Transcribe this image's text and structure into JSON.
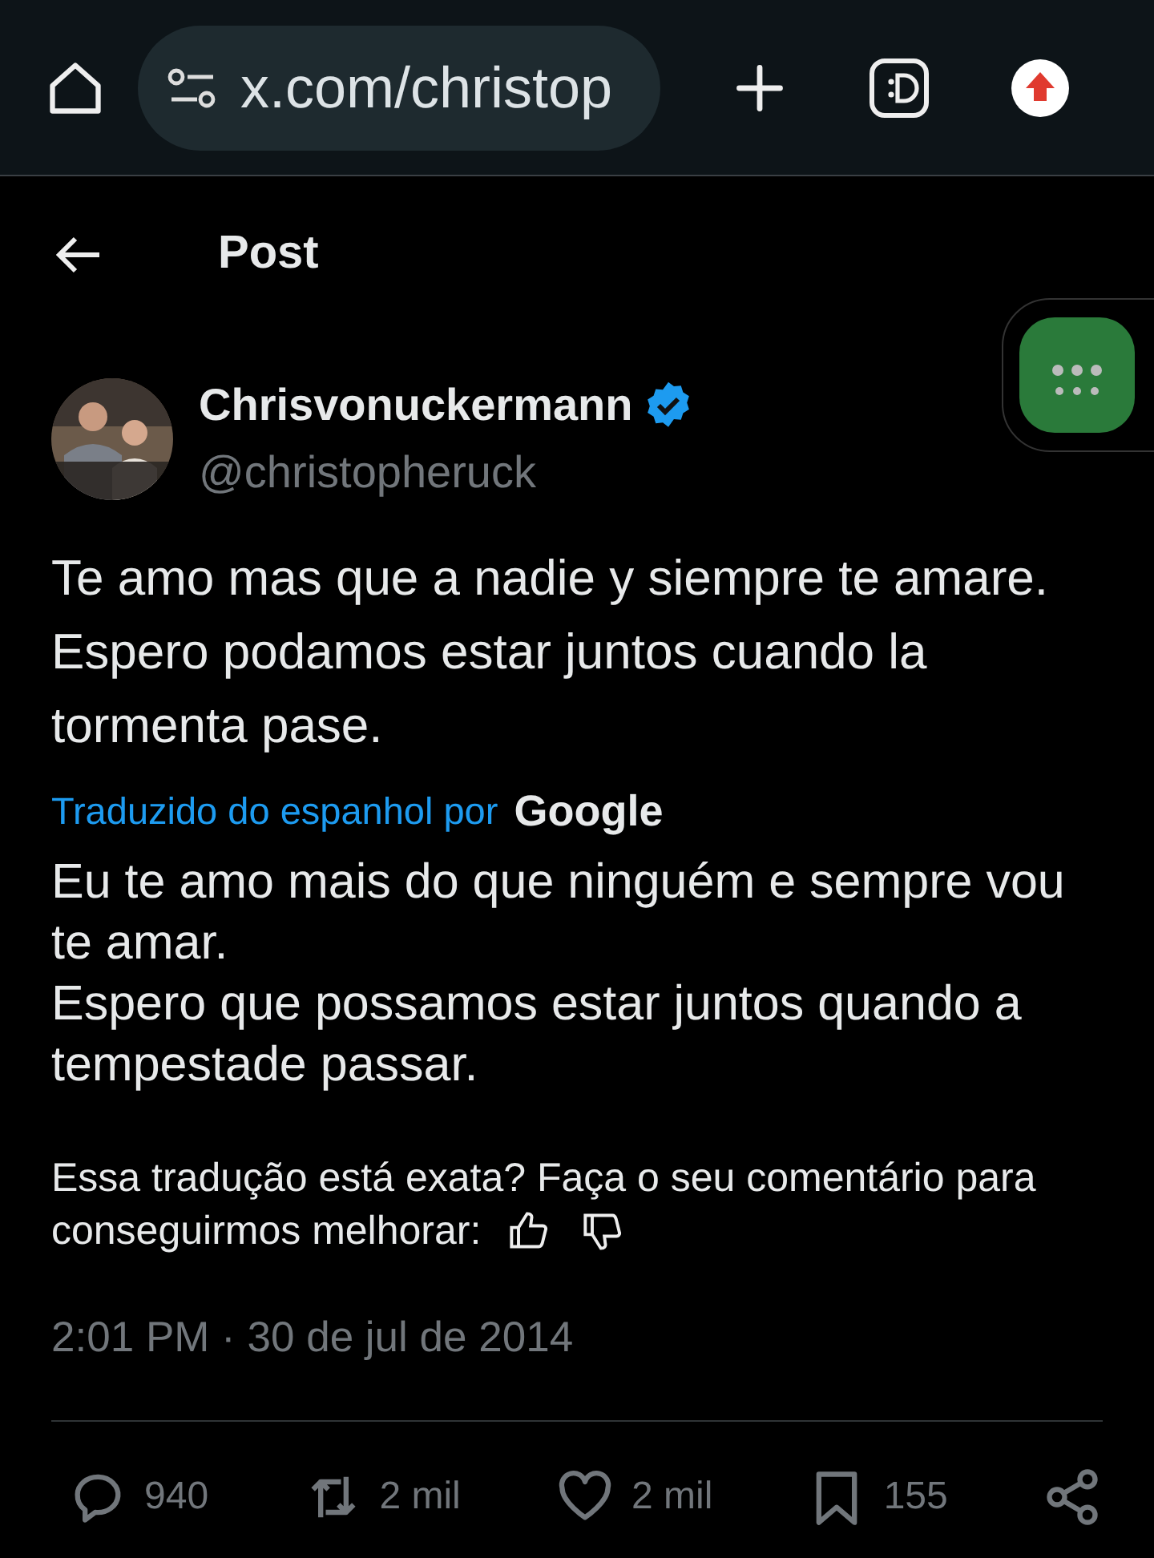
{
  "browser": {
    "url": "x.com/christop"
  },
  "header": {
    "title": "Post"
  },
  "author": {
    "name": "Chrisvonuckermann",
    "handle": "@christopheruck",
    "verified": true
  },
  "text": [
    "Te amo mas que a nadie y siempre te amare.",
    "Espero podamos estar juntos cuando la tormenta pase."
  ],
  "translation": {
    "label": "Traduzido do espanhol por",
    "provider": "Google",
    "text": [
      "Eu te amo mais do que ninguém e sempre vou te amar.",
      "Espero que possamos estar juntos quando a tempestade passar."
    ]
  },
  "feedback": [
    "Essa tradução está exata? Faça o seu comentário para",
    "conseguirmos melhorar:"
  ],
  "timestamp": "2:01 PM · 30 de jul de 2014",
  "actions": [
    {
      "kind": "reply",
      "count": "940"
    },
    {
      "kind": "repost",
      "count": "2 mil"
    },
    {
      "kind": "like",
      "count": "2 mil"
    },
    {
      "kind": "bookmark",
      "count": "155"
    },
    {
      "kind": "share"
    }
  ]
}
